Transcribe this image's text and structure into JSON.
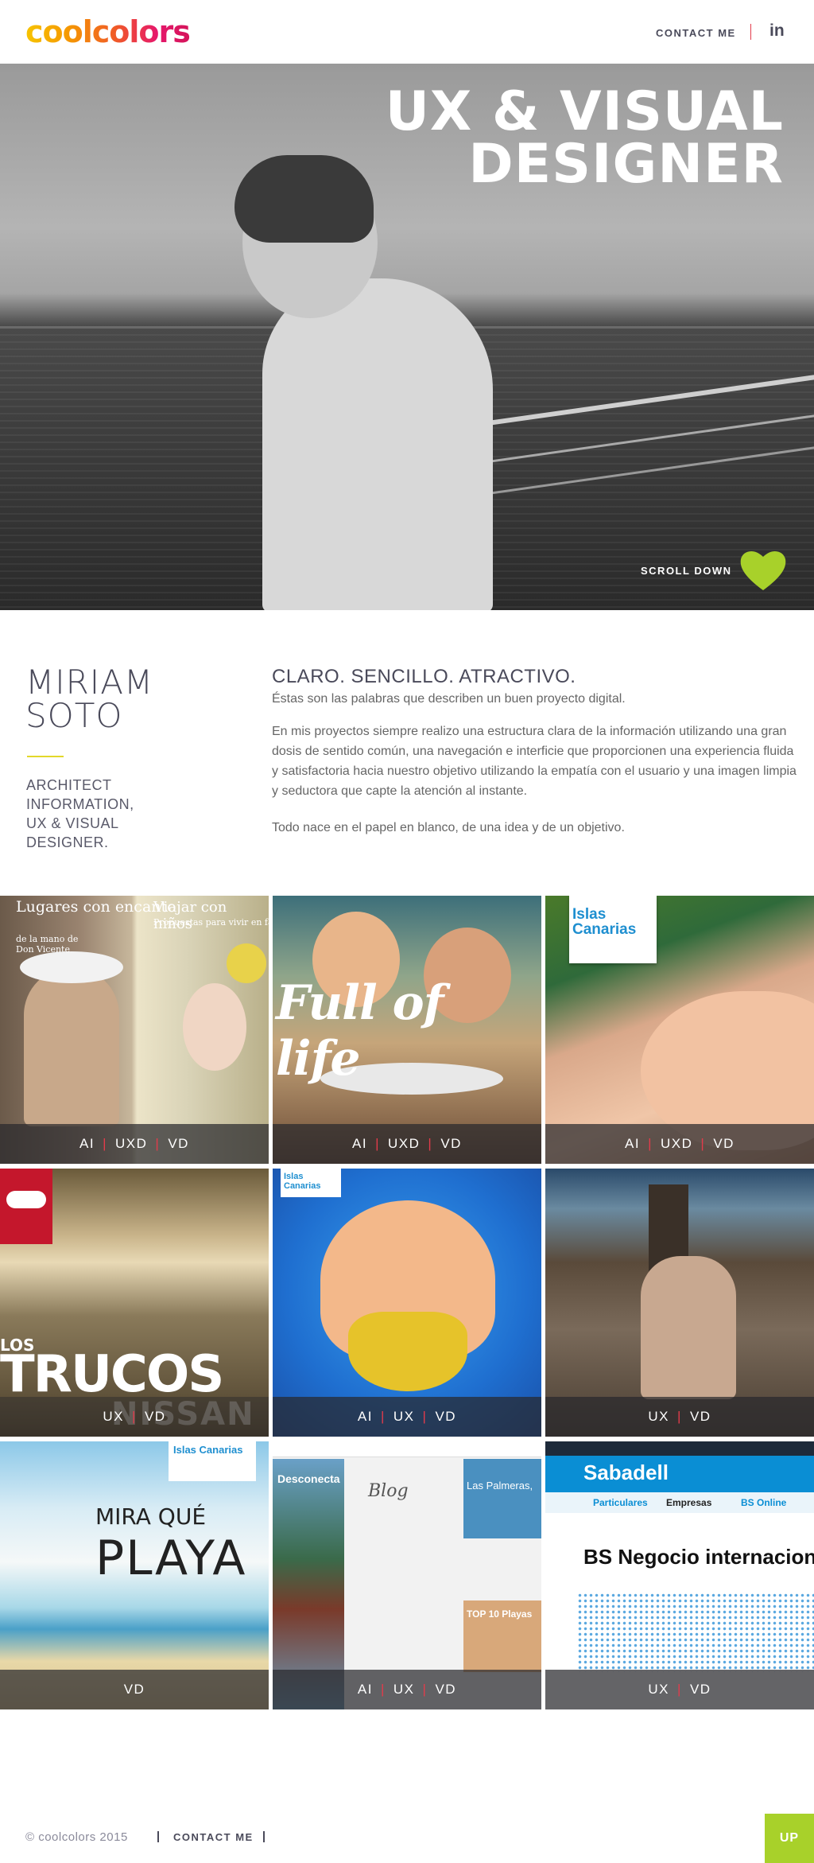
{
  "header": {
    "logo_text": "coolcolors",
    "contact_label": "CONTACT ME",
    "linkedin_label": "in"
  },
  "hero": {
    "title_line1": "UX & VISUAL",
    "title_line2": "DESIGNER",
    "scroll_label": "SCROLL DOWN",
    "heart_color": "#a8d12a"
  },
  "about": {
    "name_line1": "MIRIAM",
    "name_line2": "SOTO",
    "role_line1": "ARCHITECT",
    "role_line2": "INFORMATION,",
    "role_line3": "UX & VISUAL",
    "role_line4": "DESIGNER.",
    "tagline": "CLARO. SENCILLO. ATRACTIVO.",
    "lead": "Éstas son las palabras que describen un buen proyecto digital.",
    "paragraph1": "En mis proyectos siempre realizo una estructura clara de la información utilizando una gran dosis de sentido común, una navegación e interficie que proporcionen una experiencia fluida y satisfactoria hacia nuestro objetivo  utilizando la empatía con el usuario y una imagen limpia y seductora que capte la atención al instante.",
    "paragraph2": "Todo nace en el papel en blanco, de una idea y de un objetivo."
  },
  "portfolio": [
    {
      "tags": [
        "AI",
        "UXD",
        "VD"
      ],
      "caption1": "Lugares con encanto",
      "caption2": "Viajar con niños",
      "sub1": "de la mano de Don Vicente",
      "sub2": "Propuestas para vivir en fam"
    },
    {
      "tags": [
        "AI",
        "UXD",
        "VD"
      ],
      "caption1": "Full of life"
    },
    {
      "tags": [
        "AI",
        "UXD",
        "VD"
      ],
      "caption1": "Islas Canarias"
    },
    {
      "tags": [
        "UX",
        "VD"
      ],
      "caption1": "LOS",
      "caption2": "TRUCOS",
      "caption3": "NISSAN"
    },
    {
      "tags": [
        "AI",
        "UX",
        "VD"
      ],
      "caption1": "Islas Canarias"
    },
    {
      "tags": [
        "UX",
        "VD"
      ]
    },
    {
      "tags": [
        "VD"
      ],
      "caption1": "MIRA QUÉ",
      "caption2": "PLAYA",
      "caption3": "Islas Canarias"
    },
    {
      "tags": [
        "AI",
        "UX",
        "VD"
      ],
      "caption1": "Blog",
      "caption2": "Desconecta",
      "caption3": "Las Palmeras,",
      "caption4": "TOP 10 Playas"
    },
    {
      "tags": [
        "UX",
        "VD"
      ],
      "caption1": "Sabadell",
      "caption2": "BS Negocio internacion",
      "caption3": "Particulares",
      "caption4": "Empresas",
      "caption5": "BS Online"
    }
  ],
  "footer": {
    "copyright": "© coolcolors 2015",
    "contact_label": "CONTACT ME",
    "up_label": "UP",
    "up_color": "#a8d12a"
  }
}
